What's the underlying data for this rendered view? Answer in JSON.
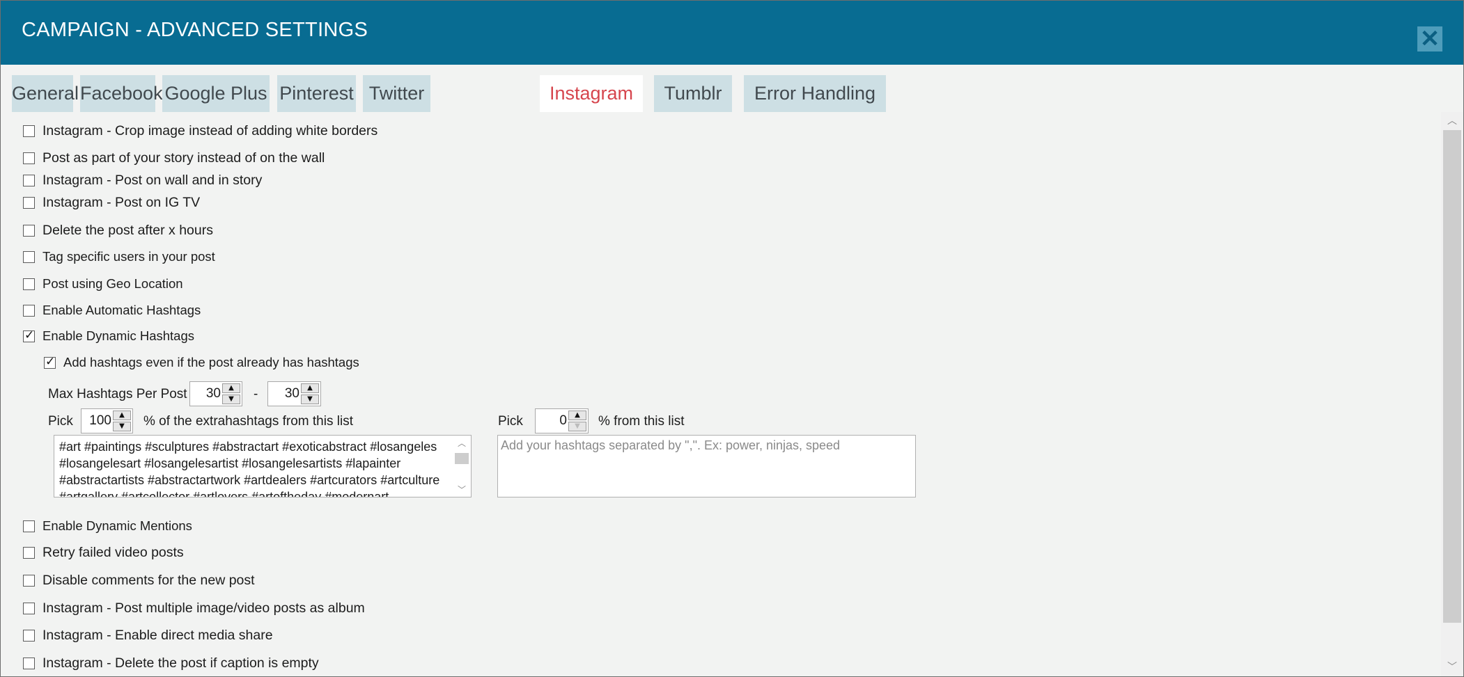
{
  "window": {
    "title": "CAMPAIGN - ADVANCED SETTINGS",
    "close_icon": "close-icon"
  },
  "tabs": [
    {
      "label": "General"
    },
    {
      "label": "Facebook"
    },
    {
      "label": "Google Plus"
    },
    {
      "label": "Pinterest"
    },
    {
      "label": "Twitter"
    },
    {
      "label": "Instagram",
      "active": true
    },
    {
      "label": "Tumblr"
    },
    {
      "label": "Error Handling"
    }
  ],
  "options": {
    "crop_image": {
      "label": "Instagram - Crop image instead of adding white borders",
      "checked": false
    },
    "story_instead": {
      "label": "Post as part of your story instead of on the wall",
      "checked": false
    },
    "wall_and_story": {
      "label": "Instagram - Post on wall and in story",
      "checked": false
    },
    "ig_tv": {
      "label": "Instagram - Post on IG TV",
      "checked": false
    },
    "delete_after": {
      "label": "Delete the post after x hours",
      "checked": false
    },
    "tag_users": {
      "label": "Tag specific users in your post",
      "checked": false
    },
    "geo_location": {
      "label": "Post using Geo Location",
      "checked": false
    },
    "auto_hashtags": {
      "label": "Enable Automatic Hashtags",
      "checked": false
    },
    "dynamic_hashtags": {
      "label": "Enable Dynamic Hashtags",
      "checked": true
    },
    "add_hashtags_existing": {
      "label": "Add hashtags even if the post already has hashtags",
      "checked": true
    },
    "dynamic_mentions": {
      "label": "Enable Dynamic Mentions",
      "checked": false
    },
    "retry_video": {
      "label": "Retry failed video posts",
      "checked": false
    },
    "disable_comments": {
      "label": "Disable comments for the new post",
      "checked": false
    },
    "album": {
      "label": "Instagram - Post multiple image/video posts as album",
      "checked": false
    },
    "direct_share": {
      "label": "Instagram - Enable direct media share",
      "checked": false
    },
    "delete_empty_caption": {
      "label": "Instagram - Delete the post if caption is empty",
      "checked": false
    }
  },
  "hashtags": {
    "max_label": "Max Hashtags Per Post",
    "max_min": "30",
    "separator": "-",
    "max_max": "30",
    "pick_label": "Pick",
    "pick_extra_value": "100",
    "pick_extra_suffix": "% of the extrahashtags from this list",
    "extra_lines": [
      "#art #paintings #sculptures #abstractart #exoticabstract #losangeles",
      "#losangelesart #losangelesartist #losangelesartists #lapainter",
      "#abstractartists #abstractartwork #artdealers #artcurators #artculture",
      "#artgallery #artcollector #artlovers #artoftheday #modernart"
    ],
    "pick_custom_value": "0",
    "pick_custom_suffix": "% from this list",
    "custom_placeholder": "Add your hashtags separated by \",\". Ex: power, ninjas, speed"
  },
  "icons": {
    "spin_up": "▲",
    "spin_down": "▼",
    "scroll_up": "︿",
    "scroll_down": "﹀"
  }
}
